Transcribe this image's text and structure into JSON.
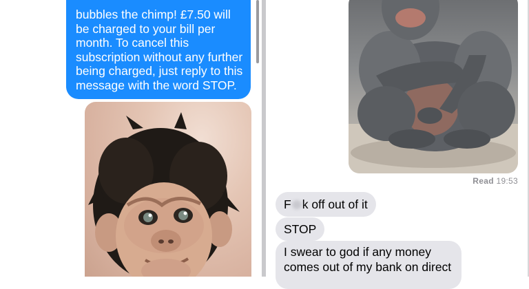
{
  "left_panel": {
    "outgoing_message": "bubbles the chimp! £7.50 will be charged to your bill per month. To cancel this subscription without any further being charged, just reply to this message with the word STOP."
  },
  "right_panel": {
    "read_status": "Read",
    "read_time": "19:53",
    "messages": [
      {
        "pre": "F",
        "post": "k off out of it"
      },
      {
        "text": "STOP"
      },
      {
        "text": "I swear to god if any money comes out of my bank on direct"
      }
    ]
  },
  "colors": {
    "outgoing_bubble": "#1a8cff",
    "incoming_bubble": "#e5e5ea",
    "divider": "#c9c9cc"
  }
}
